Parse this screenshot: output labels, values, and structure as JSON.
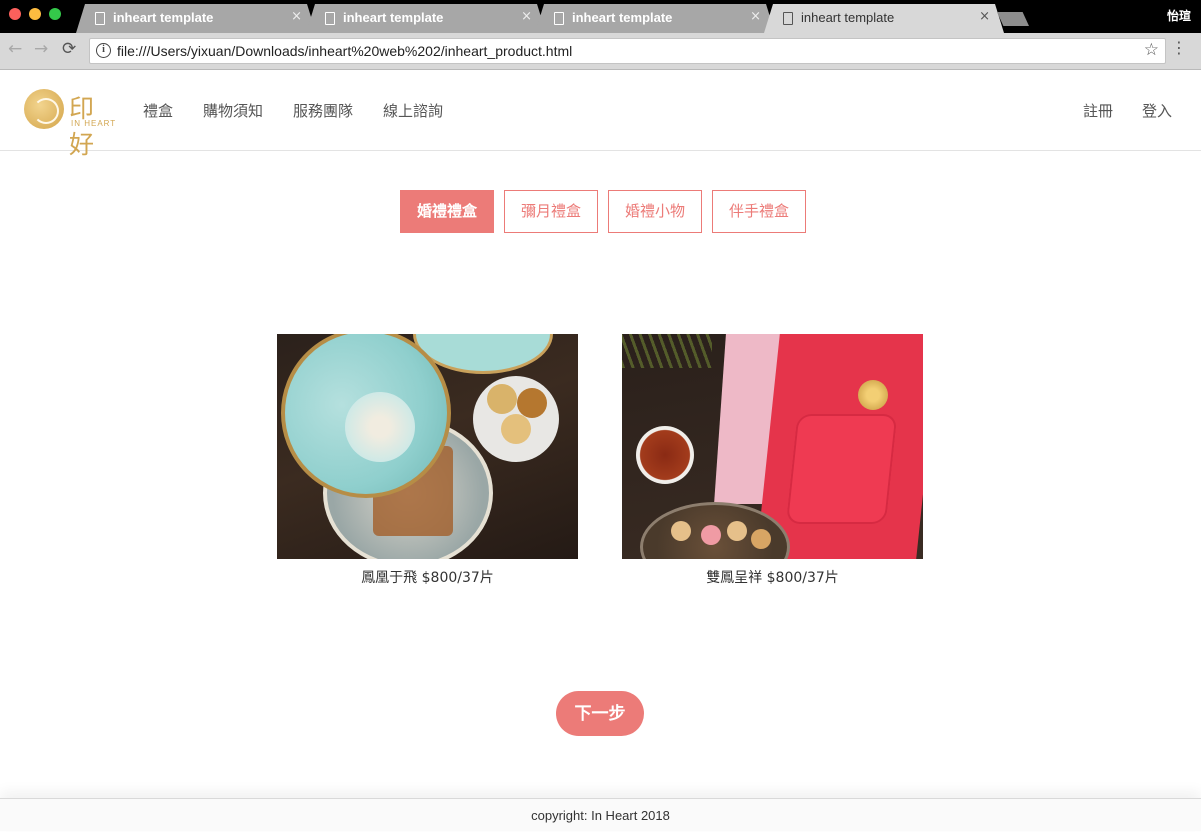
{
  "browser": {
    "tabs": [
      {
        "title": "inheart template",
        "close": "×",
        "active": false
      },
      {
        "title": "inheart template",
        "close": "×",
        "active": false
      },
      {
        "title": "inheart template",
        "close": "×",
        "active": false
      },
      {
        "title": "inheart template",
        "close": "×",
        "active": true
      }
    ],
    "os_user": "怡瑄",
    "url": "file:///Users/yixuan/Downloads/inheart%20web%202/inheart_product.html",
    "info_glyph": "i",
    "back_glyph": "←",
    "forward_glyph": "→",
    "reload_glyph": "⟳",
    "star_glyph": "☆",
    "menu_glyph": "⋮"
  },
  "site": {
    "logo": {
      "cn": "印好",
      "en": "IN HEART"
    },
    "nav": [
      "禮盒",
      "購物須知",
      "服務團隊",
      "線上諮詢"
    ],
    "auth": {
      "register": "註冊",
      "login": "登入"
    }
  },
  "categories": [
    {
      "label": "婚禮禮盒",
      "active": true
    },
    {
      "label": "彌月禮盒",
      "active": false
    },
    {
      "label": "婚禮小物",
      "active": false
    },
    {
      "label": "伴手禮盒",
      "active": false
    }
  ],
  "products": [
    {
      "caption": "鳳凰于飛 $800/37片"
    },
    {
      "caption": "雙鳳呈祥 $800/37片"
    }
  ],
  "next_button": "下一步",
  "footer": "copyright: In Heart 2018",
  "colors": {
    "accent": "#ec7b78",
    "logo_gold": "#d2a651"
  }
}
